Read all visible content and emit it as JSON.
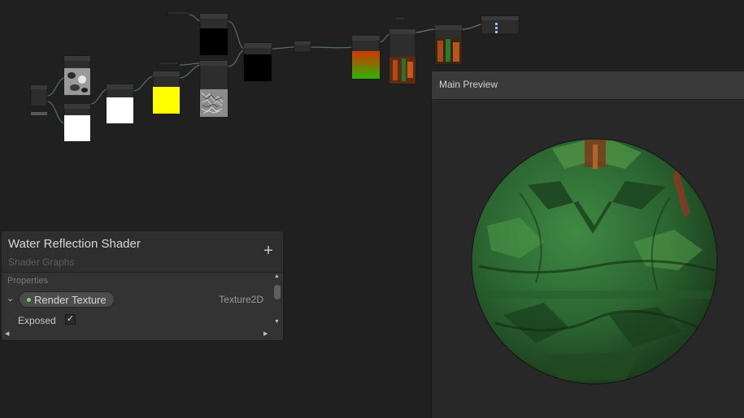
{
  "blackboard": {
    "title": "Water Reflection Shader",
    "subtitle": "Shader Graphs",
    "section_label": "Properties",
    "add_icon": "plus-icon",
    "property": {
      "name": "Render Texture",
      "type": "Texture2D",
      "exposed_label": "Exposed",
      "exposed": true
    }
  },
  "main_preview": {
    "title": "Main Preview"
  },
  "colors": {
    "graph_background": "#202020",
    "property_dot": "#8fd06b",
    "preview_yellow": "#ffff00",
    "sphere_green": "#2f6e33"
  }
}
